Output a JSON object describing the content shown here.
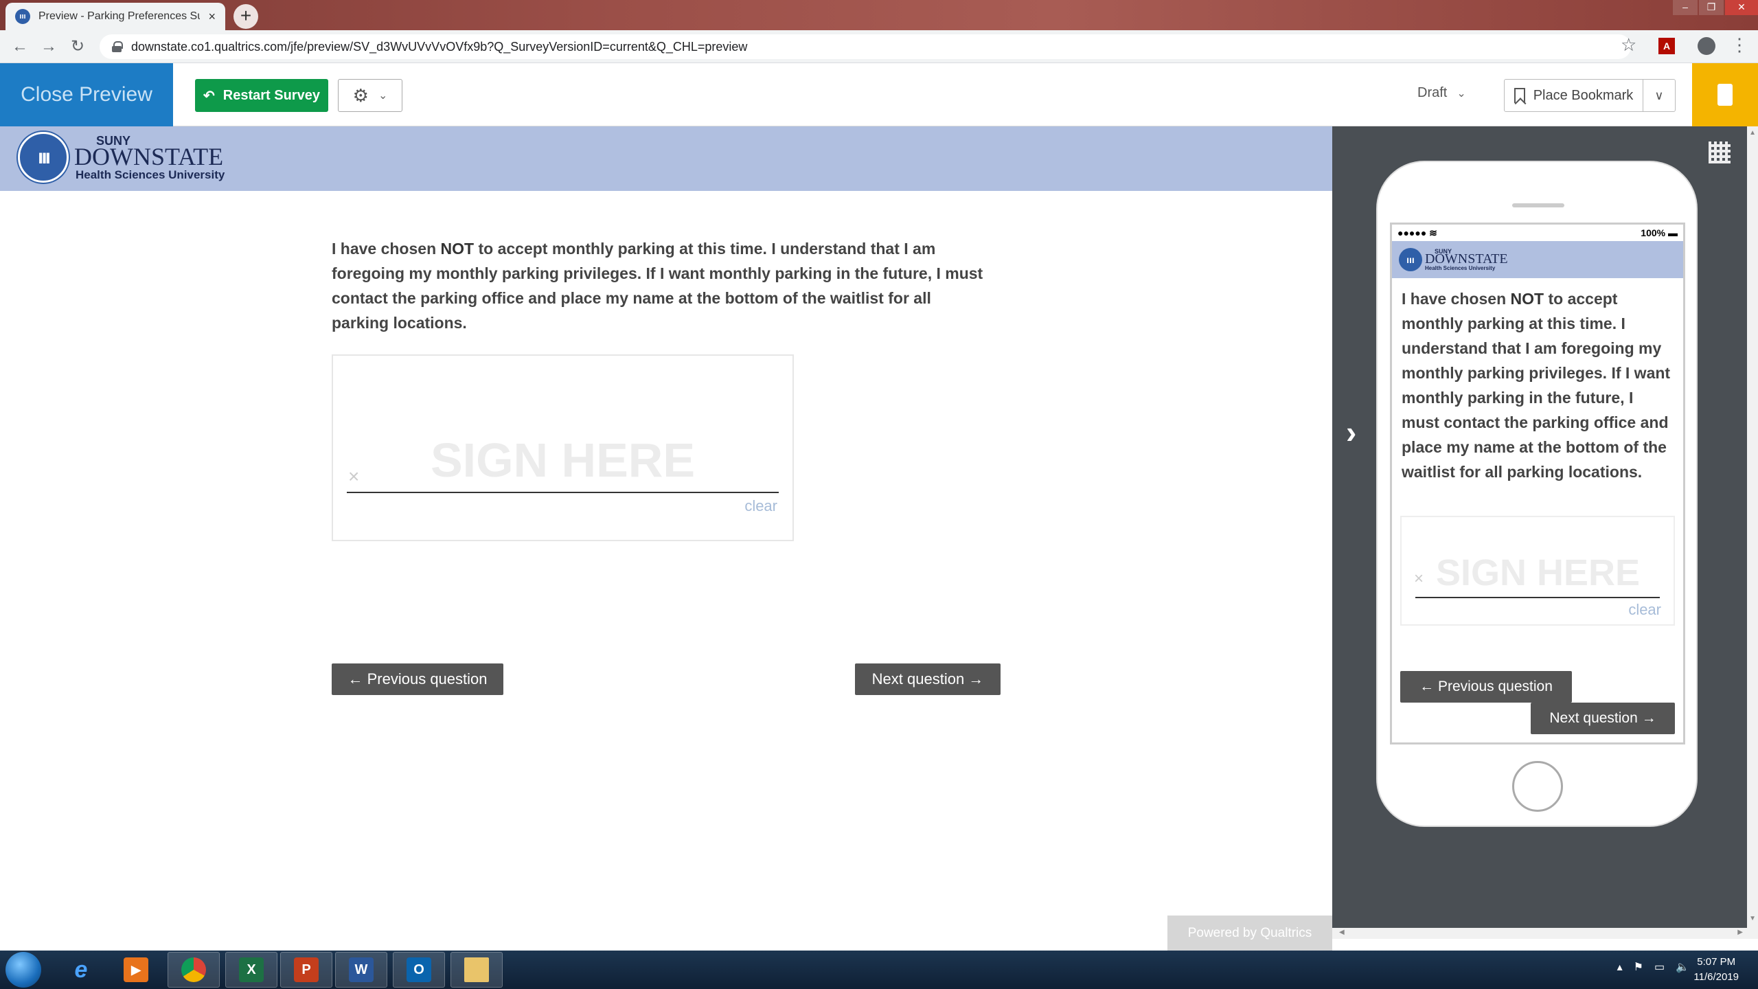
{
  "browser": {
    "tab_title": "Preview - Parking Preferences Su",
    "tab_close": "×",
    "new_tab": "+",
    "url": "downstate.co1.qualtrics.com/jfe/preview/SV_d3WvUVvVvOVfx9b?Q_SurveyVersionID=current&Q_CHL=preview",
    "window_controls": [
      "‒",
      "❐",
      "✕"
    ]
  },
  "toolbar": {
    "close_preview": "Close Preview",
    "restart_survey": "Restart Survey",
    "draft_label": "Draft",
    "place_bookmark": "Place Bookmark"
  },
  "logo": {
    "suny": "SUNY",
    "downstate": "DOWNSTATE",
    "university": "Health Sciences University"
  },
  "survey": {
    "question_before": "I have chosen ",
    "question_emphasis": "NOT",
    "question_after": " to accept monthly parking at this time. I understand that I am foregoing my monthly parking privileges. If I want monthly parking in the future, I must contact the parking office and place my name at the bottom of the waitlist for all parking locations.",
    "signature_placeholder": "SIGN HERE",
    "signature_x": "×",
    "clear_label": "clear",
    "previous_button": "← Previous question",
    "next_button": "Next question →",
    "powered_by": "Powered by Qualtrics"
  },
  "mobile": {
    "signal": "●●●●● ≋",
    "battery": "100% ▬",
    "previous_button": "← Previous question",
    "next_button": "Next question →"
  },
  "taskbar": {
    "time": "5:07 PM",
    "date": "11/6/2019"
  },
  "colors": {
    "close_preview_bg": "#1d7cc5",
    "restart_green": "#0e9a4a",
    "header_band": "#b0bfe0",
    "panel_bg": "#4a4f54",
    "bookmark_yellow": "#f4b400"
  }
}
